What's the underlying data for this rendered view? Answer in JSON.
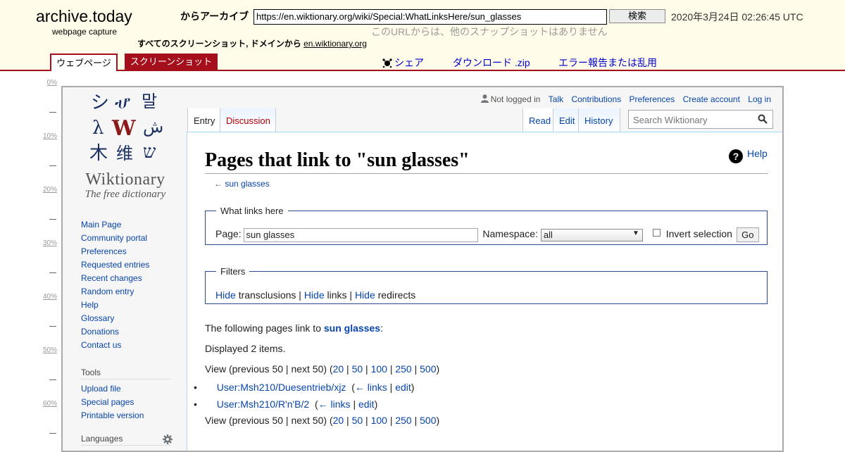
{
  "archive": {
    "logo": "archive.today",
    "subtitle": "webpage capture",
    "from_label": "からアーカイブ",
    "url": "https://en.wiktionary.org/wiki/Special:WhatLinksHere/sun_glasses",
    "search_button": "検索",
    "date": "2020年3月24日 02:26:45 UTC",
    "no_snapshots": "このURLからは、他のスナップショットはありません",
    "all_screenshots_prefix": "すべてのスクリーンショット, ドメインから",
    "domain_link": "en.wiktionary.org",
    "tabs": {
      "webpage": "ウェブページ",
      "screenshot": "スクリーンショット"
    },
    "share": "シェア",
    "download": "ダウンロード .zip",
    "report": "エラー報告または乱用",
    "accent_color": "#a50e1b"
  },
  "ruler": {
    "labels": [
      "0%",
      "10%",
      "20%",
      "30%",
      "40%",
      "50%",
      "60%"
    ]
  },
  "wiki": {
    "logo_title": "Wiktionary",
    "logo_tagline": "The free dictionary",
    "personal": {
      "not_logged_in": "Not logged in",
      "talk": "Talk",
      "contributions": "Contributions",
      "preferences": "Preferences",
      "create_account": "Create account",
      "log_in": "Log in"
    },
    "tabs": {
      "entry": "Entry",
      "discussion": "Discussion",
      "read": "Read",
      "edit": "Edit",
      "history": "History"
    },
    "search_placeholder": "Search Wiktionary",
    "sidebar": {
      "nav": [
        "Main Page",
        "Community portal",
        "Preferences",
        "Requested entries",
        "Recent changes",
        "Random entry",
        "Help",
        "Glossary",
        "Donations",
        "Contact us"
      ],
      "tools_heading": "Tools",
      "tools": [
        "Upload file",
        "Special pages",
        "Printable version"
      ],
      "languages_heading": "Languages"
    },
    "page": {
      "title": "Pages that link to \"sun glasses\"",
      "help": "Help",
      "backlink_arrow": "←",
      "backlink": "sun glasses",
      "whatlinks": {
        "legend": "What links here",
        "page_label": "Page:",
        "page_value": "sun glasses",
        "namespace_label": "Namespace:",
        "namespace_value": "all",
        "invert_label": "Invert selection",
        "go": "Go"
      },
      "filters": {
        "legend": "Filters",
        "hide1": "Hide",
        "text1": "transclusions",
        "sep1": "|",
        "hide2": "Hide",
        "text2": "links",
        "sep2": "|",
        "hide3": "Hide",
        "text3": "redirects"
      },
      "following_prefix": "The following pages link to",
      "following_target": "sun glasses",
      "following_suffix": ":",
      "displayed": "Displayed 2 items.",
      "view_prefix": "View (previous 50 | next 50) (",
      "view_options": [
        "20",
        "50",
        "100",
        "250",
        "500"
      ],
      "view_suffix": ")",
      "results": [
        {
          "title": "User:Msh210/Duesentrieb/xjz",
          "links": "← links",
          "edit": "edit"
        },
        {
          "title": "User:Msh210/R'n'B/2",
          "links": "← links",
          "edit": "edit"
        }
      ]
    }
  }
}
